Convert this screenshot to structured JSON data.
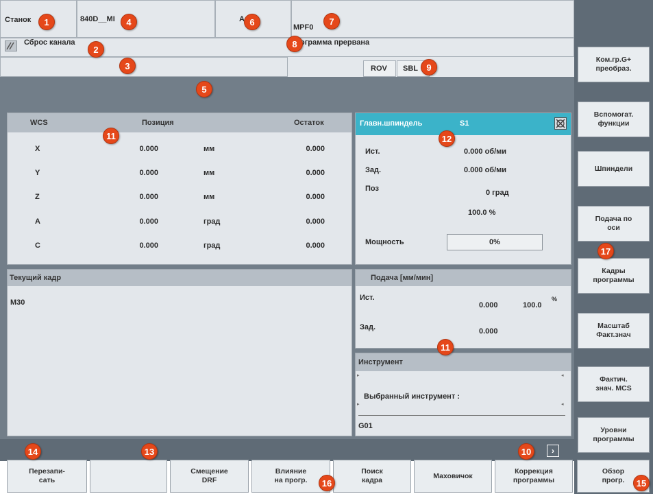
{
  "header": {
    "machine_label": "Станок",
    "channel_name": "840D__MI",
    "mode_short": "A",
    "program_name": "MPF0",
    "channel_status": "Сброс канала",
    "program_status": "ограмма прервана",
    "status_flags": [
      "ROV",
      "SBL"
    ]
  },
  "axes": {
    "col_coord": "WCS",
    "col_position": "Позиция",
    "col_remain": "Остаток",
    "rows": [
      {
        "axis": "X",
        "position": "0.000",
        "unit": "мм",
        "remain": "0.000"
      },
      {
        "axis": "Y",
        "position": "0.000",
        "unit": "мм",
        "remain": "0.000"
      },
      {
        "axis": "Z",
        "position": "0.000",
        "unit": "мм",
        "remain": "0.000"
      },
      {
        "axis": "A",
        "position": "0.000",
        "unit": "град",
        "remain": "0.000"
      },
      {
        "axis": "C",
        "position": "0.000",
        "unit": "град",
        "remain": "0.000"
      }
    ]
  },
  "spindle": {
    "title": "Главн.шпиндель",
    "id": "S1",
    "actual_label": "Ист.",
    "actual_value": "0.000 об/ми",
    "set_label": "Зад.",
    "set_value": "0.000 об/ми",
    "pos_label": "Поз",
    "pos_value": "0 град",
    "override": "100.0 %",
    "power_label": "Мощность",
    "power_value": "0%"
  },
  "current_block": {
    "title": "Текущий кадр",
    "line": "M30"
  },
  "feed": {
    "title": "Подача [мм/мин]",
    "actual_label": "Ист.",
    "actual_value": "0.000",
    "override": "100.0",
    "percent_sign": "%",
    "set_label": "Зад.",
    "set_value": "0.000"
  },
  "tool": {
    "title": "Инструмент",
    "selected_label": "Выбранный инструмент :",
    "gcode": "G01"
  },
  "vertical_softkeys": [
    "Ком.гр.G+\nпреобраз.",
    "Вспомогат.\nфункции",
    "Шпиндели",
    "Подача по\nоси",
    "Кадры\nпрограммы",
    "Масштаб\nФакт.знач",
    "Фактич.\nзнач. MCS",
    "Уровни\nпрограммы"
  ],
  "horizontal_softkeys": [
    "Перезапи-\nсать",
    "",
    "Смещение\nDRF",
    "Влияние\nна прогр.",
    "Поиск\nкадра",
    "Маховичок",
    "Коррекция\nпрограммы",
    "Обзор\nпрогр."
  ],
  "markers": [
    "1",
    "2",
    "3",
    "4",
    "5",
    "6",
    "7",
    "8",
    "9",
    "10",
    "11",
    "11",
    "12",
    "13",
    "14",
    "15",
    "16",
    "17"
  ],
  "colors": {
    "spindle_header": "#3bb3c9",
    "marker": "#e5481a",
    "frame": "#727e89"
  }
}
